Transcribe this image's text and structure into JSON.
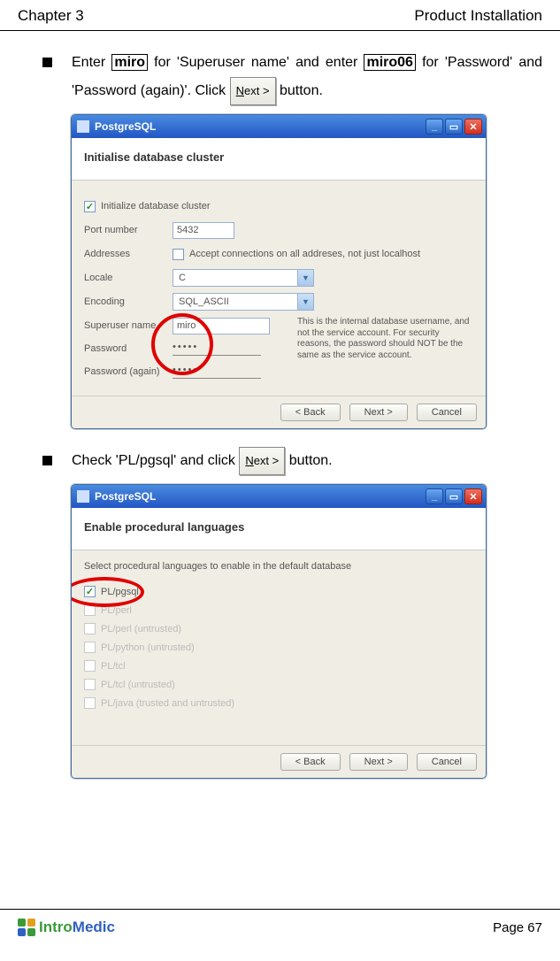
{
  "header": {
    "left": "Chapter 3",
    "right": "Product Installation"
  },
  "step1": {
    "prefix": "Enter ",
    "val1": "miro",
    "mid1": " for 'Superuser name' and enter ",
    "val2": "miro06",
    "mid2": " for 'Password' and 'Password (again)'. Click ",
    "btn": "Next >",
    "suffix": " button."
  },
  "window1": {
    "title": "PostgreSQL",
    "heading": "Initialise database cluster",
    "init_label": "Initialize database cluster",
    "port_label": "Port number",
    "port_value": "5432",
    "addr_label": "Addresses",
    "addr_cb": "Accept connections on all addreses, not just localhost",
    "locale_label": "Locale",
    "locale_value": "C",
    "encoding_label": "Encoding",
    "encoding_value": "SQL_ASCII",
    "su_label": "Superuser name",
    "su_value": "miro",
    "pw_label": "Password",
    "pw_value": "•••••",
    "pw2_label": "Password (again)",
    "pw2_value": "•••••",
    "note": "This is the internal database username, and not the service account. For security reasons, the password should NOT be the same as the service account.",
    "back": "< Back",
    "next": "Next >",
    "cancel": "Cancel"
  },
  "step2": {
    "prefix": "Check 'PL/pgsql' and click ",
    "btn": "Next >",
    "suffix": " button."
  },
  "window2": {
    "title": "PostgreSQL",
    "heading": "Enable procedural languages",
    "intro": "Select procedural languages to enable in the default database",
    "lang1": "PL/pgsql",
    "lang2": "PL/perl",
    "lang3": "PL/perl (untrusted)",
    "lang4": "PL/python (untrusted)",
    "lang5": "PL/tcl",
    "lang6": "PL/tcl (untrusted)",
    "lang7": "PL/java (trusted and untrusted)",
    "back": "< Back",
    "next": "Next >",
    "cancel": "Cancel"
  },
  "footer": {
    "brand_a": "Intro",
    "brand_b": "Medic",
    "page": "Page 67"
  }
}
